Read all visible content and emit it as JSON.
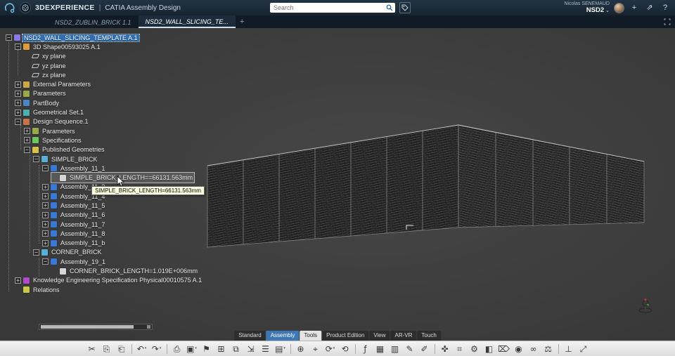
{
  "header": {
    "brand": "3DEXPERIENCE",
    "separator": "|",
    "app": "CATIA Assembly Design",
    "search": {
      "placeholder": "Search"
    },
    "user": {
      "name": "Nicolas SENEMAUD",
      "workspace": "NSD2",
      "caret": "⌄"
    },
    "actions": {
      "add": "+",
      "share": "⇗",
      "help": "?"
    }
  },
  "tabbar": {
    "tabs": [
      {
        "label": "NSD2_ZUBLIN_BRICK 1.1",
        "active": false
      },
      {
        "label": "NSD2_WALL_SLICING_TE...",
        "active": true
      }
    ],
    "add_label": "+"
  },
  "tree": [
    {
      "label": "NSD2_WALL_SLICING_TEMPLATE A.1",
      "level": 0,
      "icon": "product",
      "expand": "open",
      "selected": true
    },
    {
      "label": "3D Shape00593025 A.1",
      "level": 1,
      "icon": "shape",
      "expand": "open"
    },
    {
      "label": "xy plane",
      "level": 2,
      "icon": "plane"
    },
    {
      "label": "yz plane",
      "level": 2,
      "icon": "plane"
    },
    {
      "label": "zx plane",
      "level": 2,
      "icon": "plane"
    },
    {
      "label": "External Parameters",
      "level": 1,
      "icon": "folder",
      "expand": "closed"
    },
    {
      "label": "Parameters",
      "level": 1,
      "icon": "params",
      "expand": "closed"
    },
    {
      "label": "PartBody",
      "level": 1,
      "icon": "partbody",
      "expand": "closed"
    },
    {
      "label": "Geometrical Set.1",
      "level": 1,
      "icon": "geoset",
      "expand": "closed"
    },
    {
      "label": "Design Sequence.1",
      "level": 1,
      "icon": "sequence",
      "expand": "open"
    },
    {
      "label": "Parameters",
      "level": 2,
      "icon": "params",
      "expand": "closed"
    },
    {
      "label": "Specifications",
      "level": 2,
      "icon": "spec",
      "expand": "closed"
    },
    {
      "label": "Published Geometries",
      "level": 2,
      "icon": "published",
      "expand": "open"
    },
    {
      "label": "SIMPLE_BRICK",
      "level": 3,
      "icon": "assembly",
      "expand": "open"
    },
    {
      "label": "Assembly_11_1",
      "level": 4,
      "icon": "part",
      "expand": "open"
    },
    {
      "label": "SIMPLE_BRICK_LENGTH==66131.563mm",
      "level": 5,
      "icon": "formula",
      "hovered": true
    },
    {
      "label": "Assembly_11_3",
      "level": 4,
      "icon": "part",
      "expand": "closed"
    },
    {
      "label": "Assembly_11_4",
      "level": 4,
      "icon": "part",
      "expand": "closed"
    },
    {
      "label": "Assembly_11_5",
      "level": 4,
      "icon": "part",
      "expand": "closed"
    },
    {
      "label": "Assembly_11_6",
      "level": 4,
      "icon": "part",
      "expand": "closed"
    },
    {
      "label": "Assembly_11_7",
      "level": 4,
      "icon": "part",
      "expand": "closed"
    },
    {
      "label": "Assembly_11_8",
      "level": 4,
      "icon": "part",
      "expand": "closed"
    },
    {
      "label": "Assembly_11_b",
      "level": 4,
      "icon": "part",
      "expand": "closed"
    },
    {
      "label": "CORNER_BRICK",
      "level": 3,
      "icon": "assembly",
      "expand": "open"
    },
    {
      "label": "Assembly_19_1",
      "level": 4,
      "icon": "part",
      "expand": "open"
    },
    {
      "label": "CORNER_BRICK_LENGTH=1.019E+006mm",
      "level": 5,
      "icon": "formula"
    },
    {
      "label": "Knowledge Engineering Specification Physical00010575 A.1",
      "level": 1,
      "icon": "knowledge",
      "expand": "closed"
    },
    {
      "label": "Relations",
      "level": 1,
      "icon": "relations"
    }
  ],
  "tooltip": {
    "text": "SIMPLE_BRICK_LENGTH=66131.563mm"
  },
  "ribbon": {
    "tabs": [
      {
        "label": "Standard",
        "state": "default"
      },
      {
        "label": "Assembly",
        "state": "accent"
      },
      {
        "label": "Tools",
        "state": "selected"
      },
      {
        "label": "Product Edition",
        "state": "default"
      },
      {
        "label": "View",
        "state": "default"
      },
      {
        "label": "AR-VR",
        "state": "default"
      },
      {
        "label": "Touch",
        "state": "default"
      }
    ]
  },
  "toolbar": {
    "icons": [
      {
        "name": "cut",
        "glyph": "✂"
      },
      {
        "name": "copy",
        "glyph": "⎘"
      },
      {
        "name": "paste",
        "glyph": "⎗"
      },
      {
        "sep": true
      },
      {
        "name": "undo",
        "glyph": "↶",
        "caret": true
      },
      {
        "name": "redo",
        "glyph": "↷",
        "caret": true
      },
      {
        "sep": true
      },
      {
        "name": "print",
        "glyph": "⎙"
      },
      {
        "name": "display",
        "glyph": "▣",
        "caret": true
      },
      {
        "name": "bookmark",
        "glyph": "⚑"
      },
      {
        "name": "grid",
        "glyph": "⊞"
      },
      {
        "name": "window",
        "glyph": "⧉"
      },
      {
        "name": "export",
        "glyph": "⇲"
      },
      {
        "name": "list",
        "glyph": "☰"
      },
      {
        "name": "chart",
        "glyph": "▤",
        "caret": true
      },
      {
        "sep": true
      },
      {
        "name": "insert",
        "glyph": "⊕"
      },
      {
        "name": "target",
        "glyph": "⌖"
      },
      {
        "name": "refresh",
        "glyph": "⟳",
        "caret": true
      },
      {
        "name": "sync",
        "glyph": "⟲"
      },
      {
        "sep": true
      },
      {
        "name": "formula",
        "glyph": "ƒ"
      },
      {
        "name": "table",
        "glyph": "▦"
      },
      {
        "name": "sheet",
        "glyph": "▥"
      },
      {
        "name": "pencil",
        "glyph": "✎"
      },
      {
        "name": "knife",
        "glyph": "✐"
      },
      {
        "sep": true
      },
      {
        "name": "measure-compass",
        "glyph": "✜"
      },
      {
        "name": "measure-grid",
        "glyph": "⌗"
      },
      {
        "name": "gear",
        "glyph": "⚙"
      },
      {
        "name": "palette",
        "glyph": "◧"
      },
      {
        "name": "eraser",
        "glyph": "⌦"
      },
      {
        "name": "droplet",
        "glyph": "◉"
      },
      {
        "name": "link",
        "glyph": "∞"
      },
      {
        "name": "weight",
        "glyph": "⚖"
      },
      {
        "sep": true
      },
      {
        "name": "axis",
        "glyph": "⊥"
      },
      {
        "name": "move",
        "glyph": "⤢"
      }
    ]
  },
  "colors": {
    "accent": "#3d78b4",
    "selection": "#2f6fb2",
    "tooltip_bg": "#ffffe1",
    "viewport_bg": "#3f3f3f"
  }
}
